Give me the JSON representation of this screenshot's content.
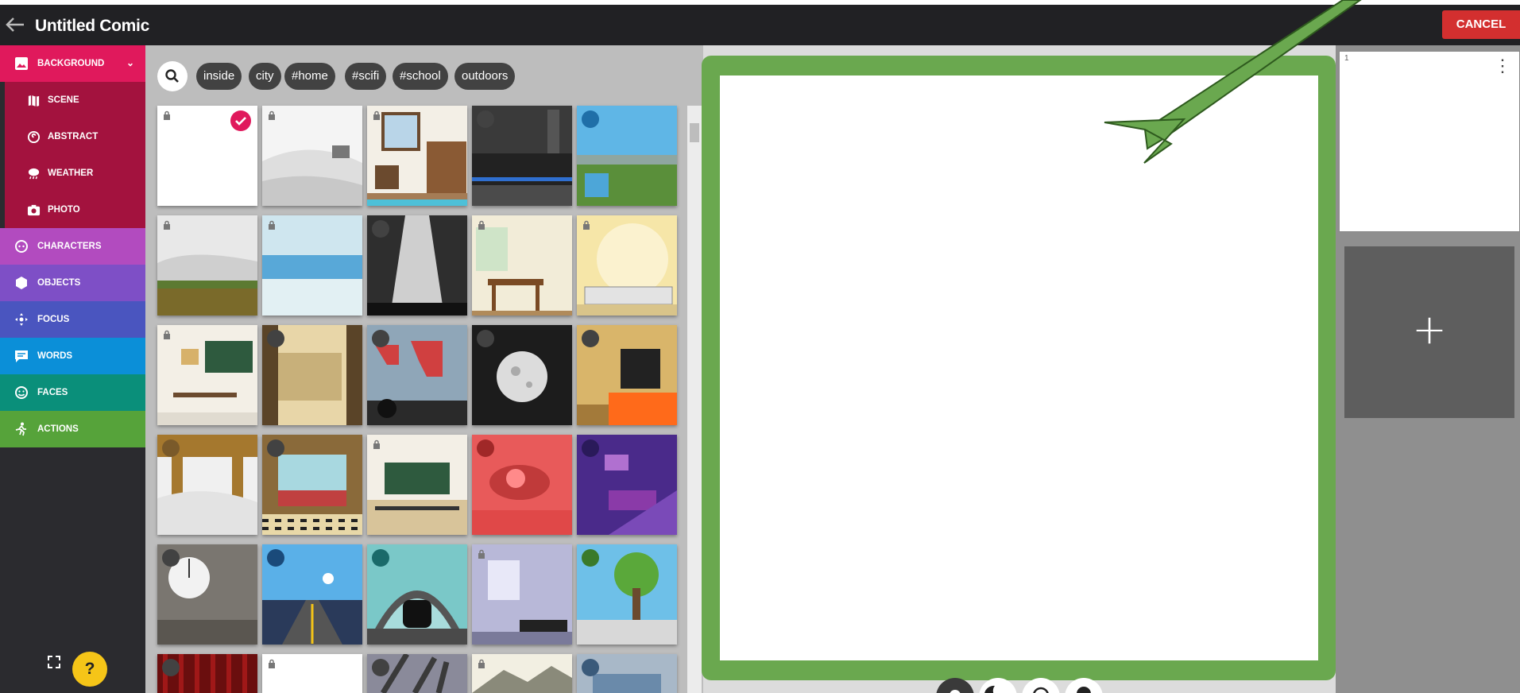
{
  "header": {
    "title": "Untitled Comic",
    "cancel_label": "CANCEL"
  },
  "nav": {
    "background": "BACKGROUND",
    "scene": "SCENE",
    "abstract": "ABSTRACT",
    "weather": "WEATHER",
    "photo": "PHOTO",
    "characters": "CHARACTERS",
    "objects": "OBJECTS",
    "focus": "FOCUS",
    "words": "WORDS",
    "faces": "FACES",
    "actions": "ACTIONS",
    "help": "?"
  },
  "tags": [
    "inside",
    "city",
    "#home",
    "#scifi",
    "#school",
    "outdoors"
  ],
  "pages": {
    "page1": "1",
    "add": "+"
  },
  "colors": {
    "background": "#e0195c",
    "subnav": "#a3123e",
    "characters": "#b24bbf",
    "objects": "#7e4fc6",
    "focus": "#4a55bf",
    "words": "#0b8fd8",
    "faces": "#0a8f7a",
    "actions": "#56a33a",
    "panel_border": "#6aa84f",
    "cancel": "#d32f2f"
  }
}
